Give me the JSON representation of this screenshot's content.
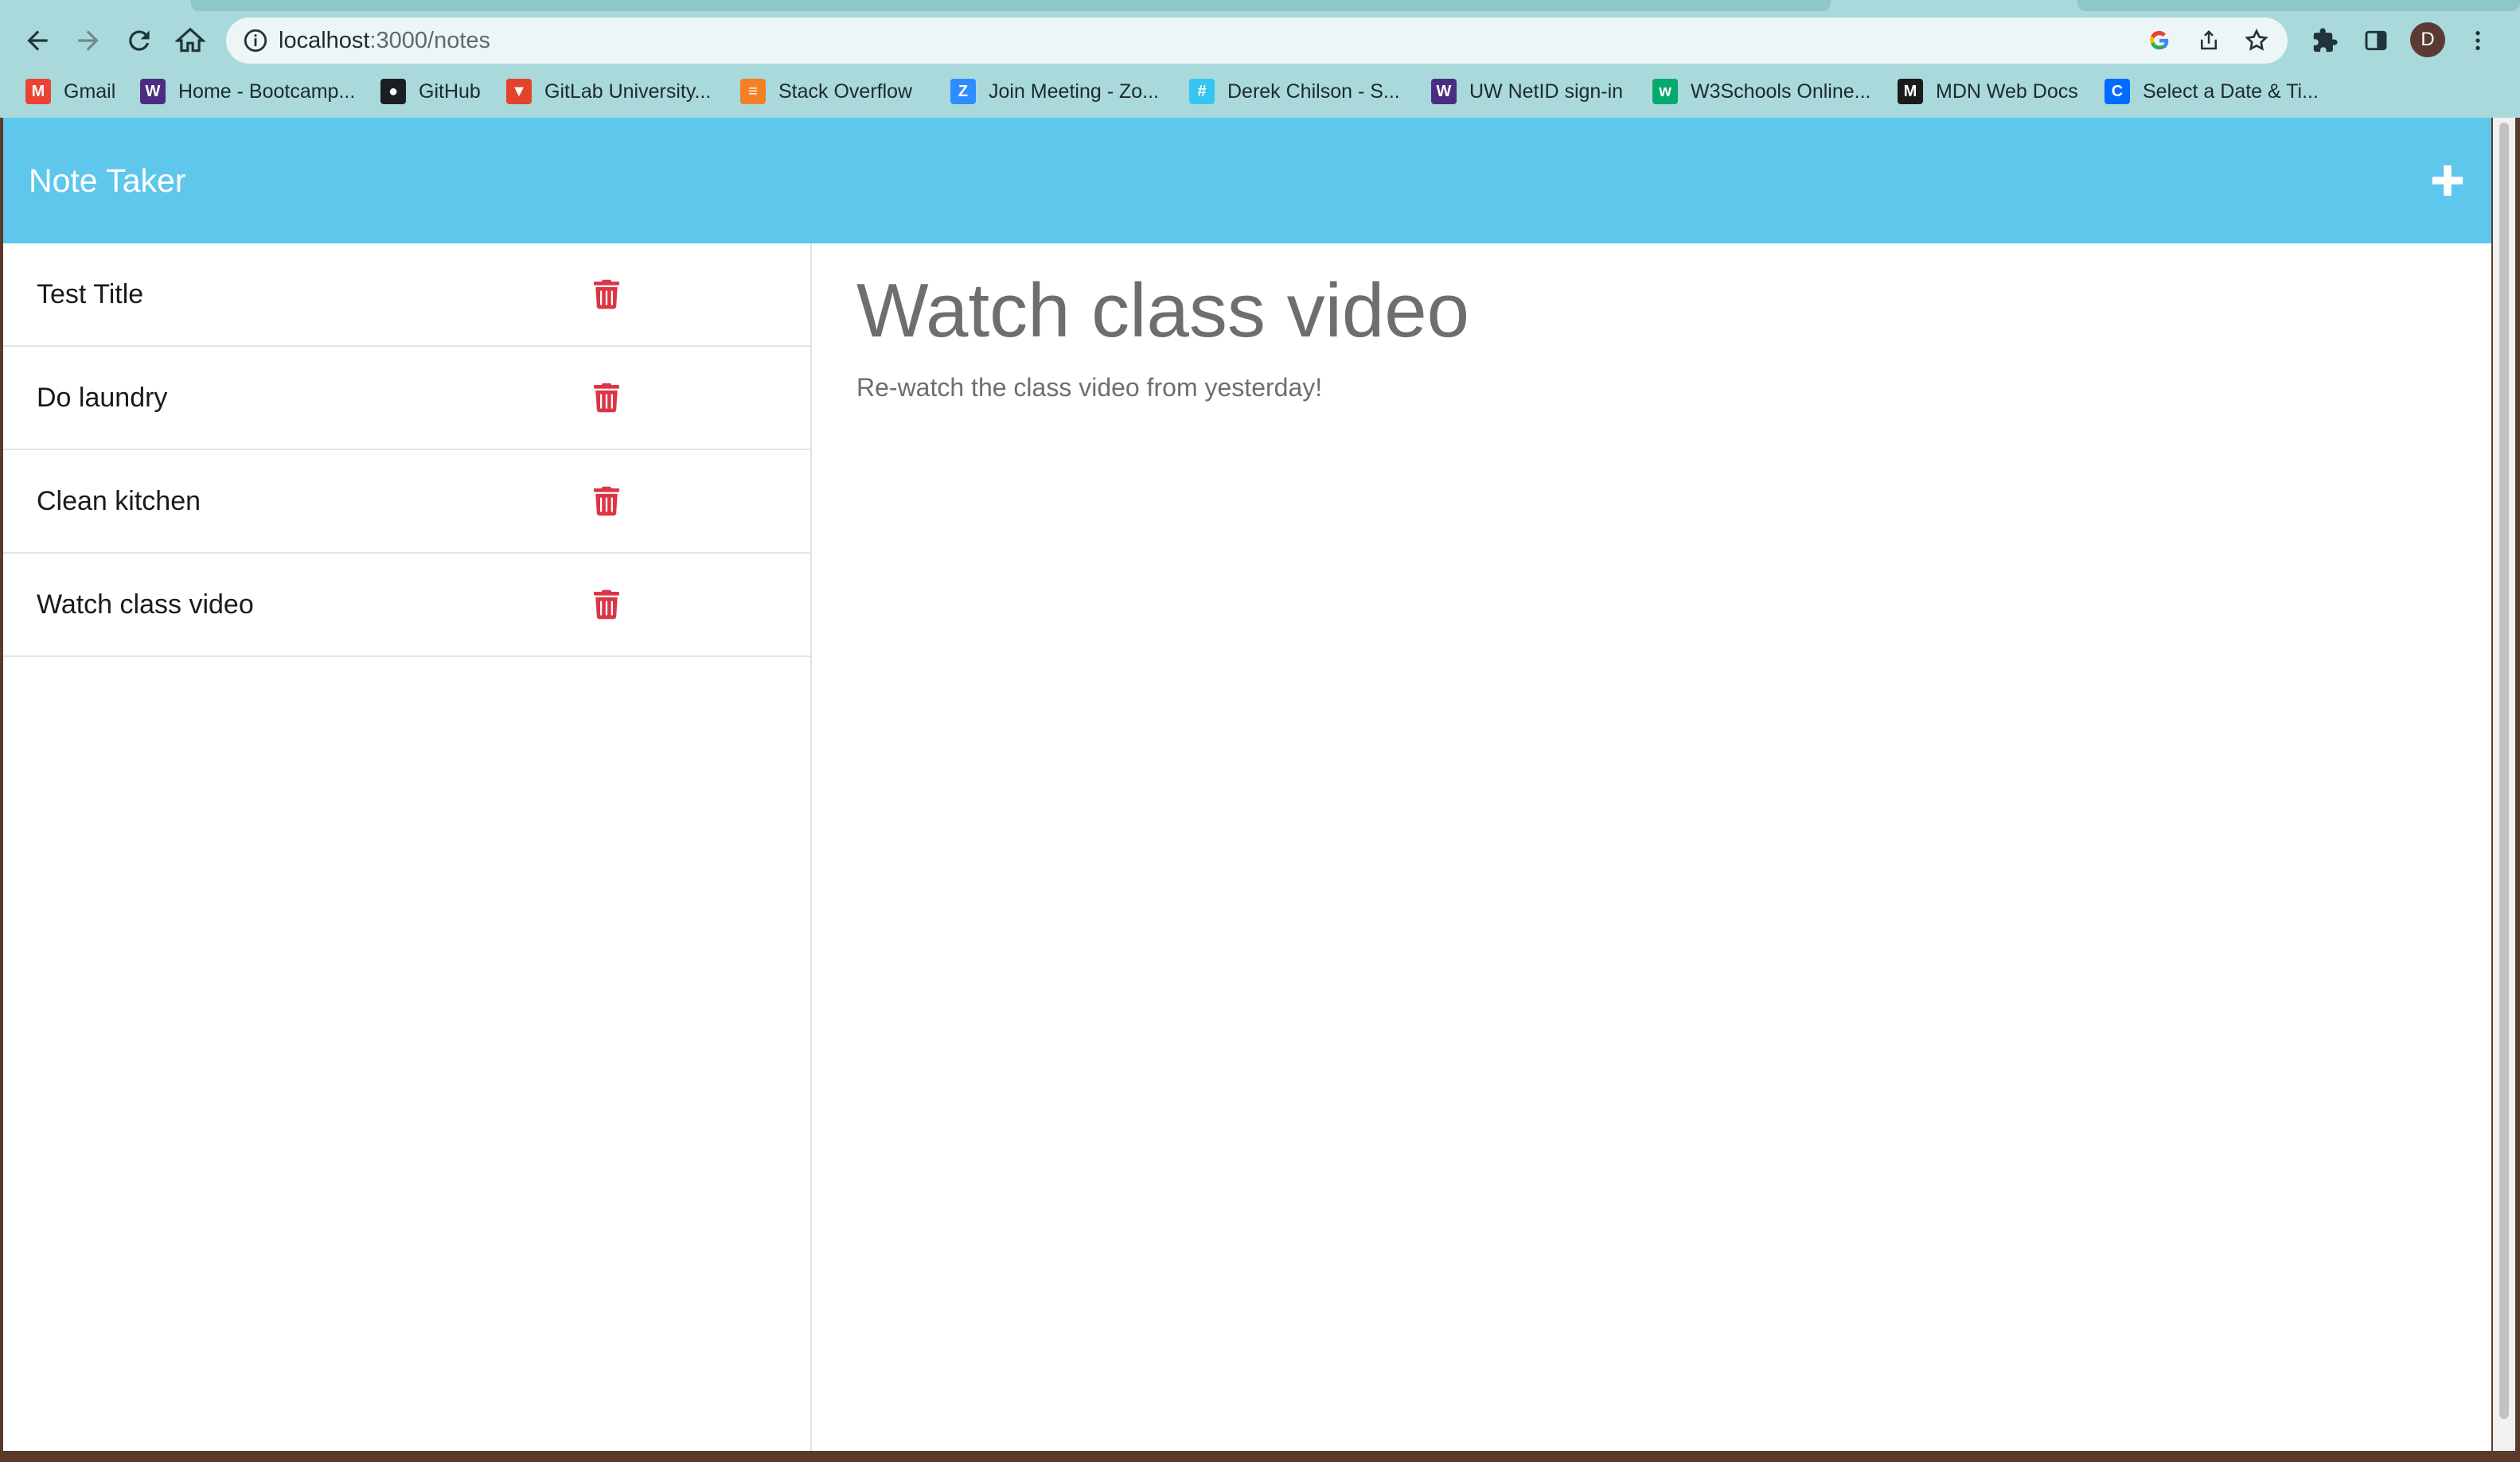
{
  "browser": {
    "url_host": "localhost",
    "url_path": ":3000/notes",
    "avatar_initial": "D",
    "bookmarks": [
      {
        "label": "Gmail",
        "icon": "gmail-icon",
        "color": "#ea4335",
        "glyph": "M"
      },
      {
        "label": "Home - Bootcamp...",
        "icon": "uw-icon",
        "color": "#4b2e83",
        "glyph": "W"
      },
      {
        "label": "GitHub",
        "icon": "github-icon",
        "color": "#1b1f23",
        "glyph": "●"
      },
      {
        "label": "GitLab University...",
        "icon": "gitlab-icon",
        "color": "#e24329",
        "glyph": "▼"
      },
      {
        "label": "Stack Overflow",
        "icon": "stackoverflow-icon",
        "color": "#f48024",
        "glyph": "≡"
      },
      {
        "label": "Join Meeting - Zo...",
        "icon": "zoom-icon",
        "color": "#2d8cff",
        "glyph": "Z"
      },
      {
        "label": "Derek Chilson - S...",
        "icon": "slack-icon",
        "color": "#36c5f0",
        "glyph": "#"
      },
      {
        "label": "UW NetID sign-in",
        "icon": "uw-icon",
        "color": "#4b2e83",
        "glyph": "W"
      },
      {
        "label": "W3Schools Online...",
        "icon": "w3schools-icon",
        "color": "#04aa6d",
        "glyph": "w"
      },
      {
        "label": "MDN Web Docs",
        "icon": "mdn-icon",
        "color": "#1b1b1b",
        "glyph": "M"
      },
      {
        "label": "Select a Date & Ti...",
        "icon": "calendly-icon",
        "color": "#006bff",
        "glyph": "C"
      }
    ]
  },
  "app": {
    "brand": "Note Taker",
    "new_note_icon": "plus-icon",
    "notes": [
      {
        "title": "Test Title"
      },
      {
        "title": "Do laundry"
      },
      {
        "title": "Clean kitchen"
      },
      {
        "title": "Watch class video"
      }
    ],
    "active_note": {
      "title": "Watch class video",
      "text": "Re-watch the class video from yesterday!"
    }
  },
  "colors": {
    "navbar": "#5fc6ec",
    "trash": "#dc3545",
    "chrome": "#a9d9db"
  }
}
